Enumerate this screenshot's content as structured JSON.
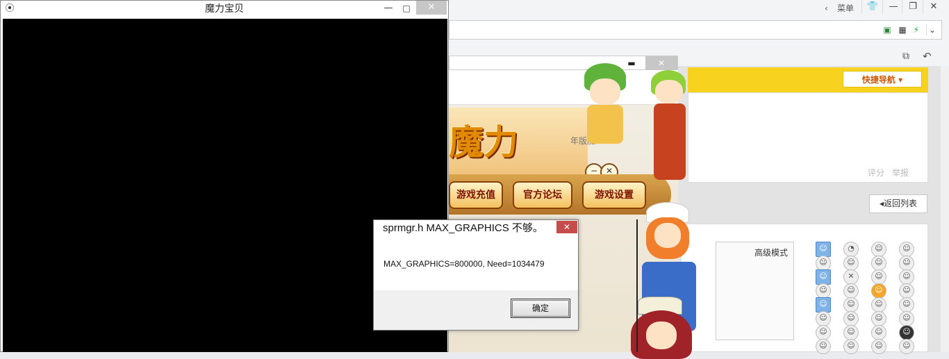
{
  "browser": {
    "menu_label": "菜单",
    "back_arrow": "‹",
    "controls": {
      "skin": "👕",
      "minimize": "—",
      "restore": "❐",
      "close": "✕"
    },
    "address_icons": [
      "qr-icon",
      "lightning-icon"
    ],
    "right_tools": [
      "window-icon",
      "undo-icon"
    ]
  },
  "forum": {
    "quick_nav": "快捷导航 ▾",
    "links": [
      "评分",
      "举报"
    ],
    "back_list": "返回列表",
    "adv_mode": "高级模式"
  },
  "launcher": {
    "game_logo_text": "魔力",
    "hint_text": "年版魔...",
    "buttons": [
      "游戏充值",
      "官方论坛",
      "游戏设置"
    ],
    "mini_buttons": [
      "−",
      "✕"
    ]
  },
  "game_window": {
    "title": "魔力宝贝",
    "minimize": "—",
    "maximize": "□",
    "close": "✕"
  },
  "dialog": {
    "title": "sprmgr.h MAX_GRAPHICS 不够。",
    "message": "MAX_GRAPHICS=800000, Need=1034479",
    "ok_label": "确定",
    "close": "✕"
  }
}
